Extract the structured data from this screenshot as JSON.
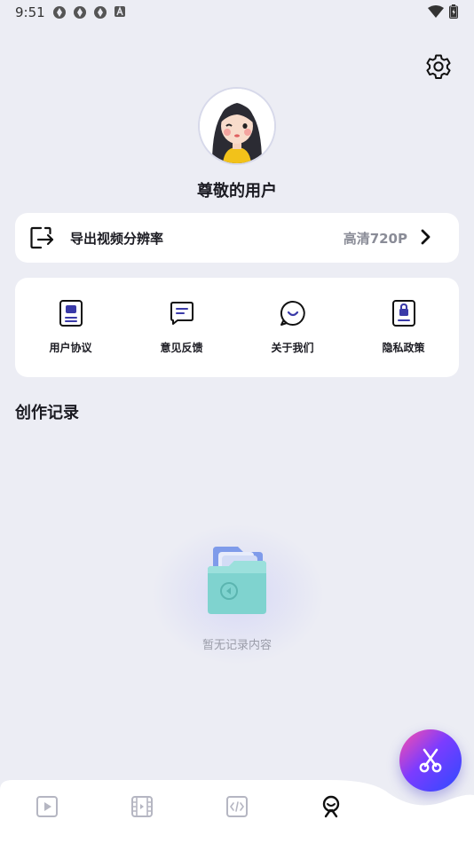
{
  "status_bar": {
    "time": "9:51"
  },
  "profile": {
    "username": "尊敬的用户"
  },
  "resolution": {
    "label": "导出视频分辨率",
    "value": "高清720P"
  },
  "menu": [
    {
      "label": "用户协议",
      "icon": "document-icon"
    },
    {
      "label": "意见反馈",
      "icon": "message-icon"
    },
    {
      "label": "关于我们",
      "icon": "chat-smile-icon"
    },
    {
      "label": "隐私政策",
      "icon": "lock-document-icon"
    }
  ],
  "records": {
    "title": "创作记录",
    "empty_text": "暂无记录内容"
  },
  "colors": {
    "background": "#ecedf4",
    "accent": "#3a3aa8",
    "inactive_tab": "#b5b6c2"
  }
}
